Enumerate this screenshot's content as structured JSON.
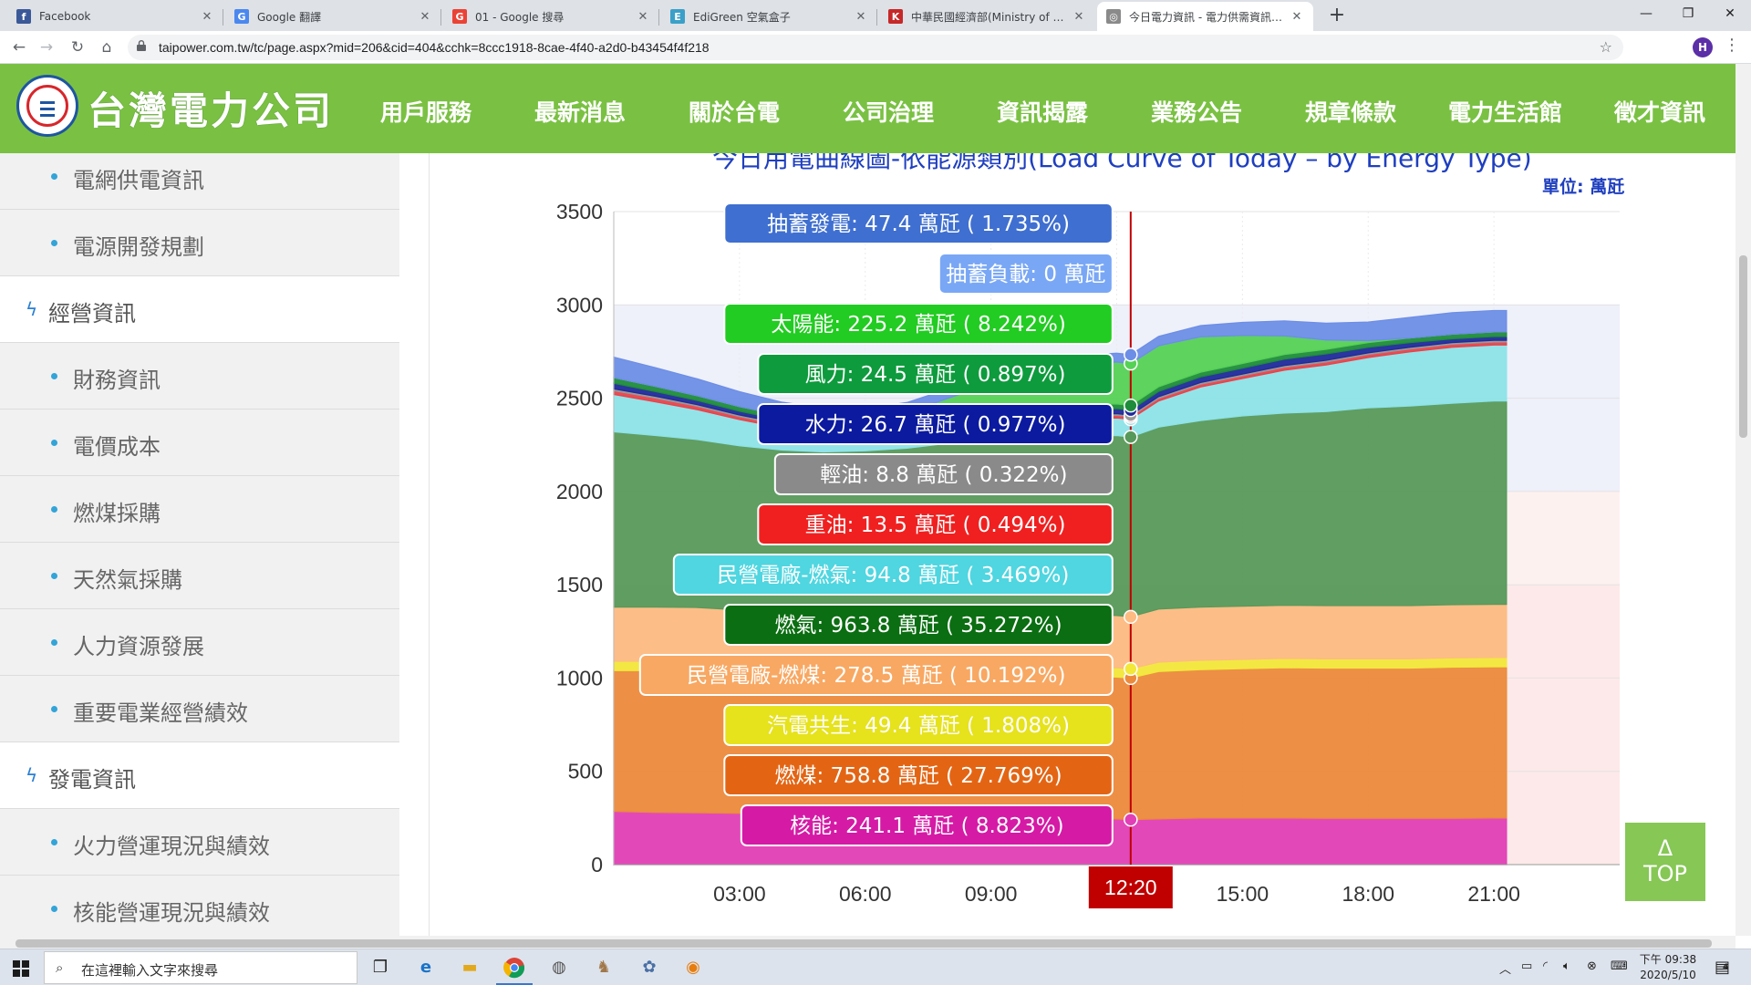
{
  "browser": {
    "tabs": [
      {
        "label": "Facebook",
        "icon": "facebook-icon",
        "color": "#3b5998",
        "glyph": "f"
      },
      {
        "label": "Google 翻譯",
        "icon": "google-translate-icon",
        "color": "#4a88ef",
        "glyph": "G"
      },
      {
        "label": "01 - Google 搜尋",
        "icon": "google-icon",
        "color": "#ea4335",
        "glyph": "G"
      },
      {
        "label": "EdiGreen 空氣盒子",
        "icon": "edigreen-icon",
        "color": "#3aa0c8",
        "glyph": "E"
      },
      {
        "label": "中華民國經濟部(Ministry of Eco",
        "icon": "moea-icon",
        "color": "#c62828",
        "glyph": "K"
      },
      {
        "label": "今日電力資訊 - 電力供需資訊 - 資",
        "icon": "taipower-icon",
        "color": "#8a8a8a",
        "glyph": "◎"
      }
    ],
    "url": "taipower.com.tw/tc/page.aspx?mid=206&cid=404&cchk=8ccc1918-8cae-4f40-a2d0-b43454f4f218",
    "profile_initial": "H"
  },
  "site": {
    "logo_text": "台灣電力公司",
    "nav": [
      "用戶服務",
      "最新消息",
      "關於台電",
      "公司治理",
      "資訊揭露",
      "業務公告",
      "規章條款",
      "電力生活館",
      "徵才資訊"
    ]
  },
  "sidebar": {
    "items": [
      {
        "label": "電網供電資訊",
        "type": "sub"
      },
      {
        "label": "電源開發規劃",
        "type": "sub"
      },
      {
        "label": "經營資訊",
        "type": "cat"
      },
      {
        "label": "財務資訊",
        "type": "sub"
      },
      {
        "label": "電價成本",
        "type": "sub"
      },
      {
        "label": "燃煤採購",
        "type": "sub"
      },
      {
        "label": "天然氣採購",
        "type": "sub"
      },
      {
        "label": "人力資源發展",
        "type": "sub"
      },
      {
        "label": "重要電業經營績效",
        "type": "sub"
      },
      {
        "label": "發電資訊",
        "type": "cat"
      },
      {
        "label": "火力營運現況與績效",
        "type": "sub"
      },
      {
        "label": "核能營運現況與績效",
        "type": "sub"
      }
    ]
  },
  "chart_data": {
    "type": "area",
    "title": "今日用電曲線圖-依能源類別(Load Curve of Today – by Energy Type)",
    "unit": "單位: 萬瓩",
    "ylim": [
      0,
      3500
    ],
    "yticks": [
      0,
      500,
      1000,
      1500,
      2000,
      2500,
      3000,
      3500
    ],
    "xticks": [
      "03:00",
      "06:00",
      "09:00",
      "15:00",
      "18:00",
      "21:00"
    ],
    "xlim": [
      0,
      24
    ],
    "cursor": "12:20",
    "x": [
      0,
      1,
      2,
      3,
      4,
      5,
      6,
      7,
      8,
      9,
      10,
      11,
      12,
      12.33,
      13,
      14,
      15,
      16,
      17,
      18,
      19,
      20,
      21,
      21.3
    ],
    "series": [
      {
        "name": "核能",
        "color": "#e23fb6",
        "tooltip": "核能: 241.1 萬瓩 ( 8.823%)",
        "values": [
          285,
          280,
          278,
          275,
          272,
          270,
          268,
          265,
          262,
          260,
          258,
          250,
          245,
          241,
          245,
          250,
          250,
          250,
          248,
          248,
          248,
          248,
          250,
          250
        ]
      },
      {
        "name": "燃煤",
        "color": "#ec8a3c",
        "tooltip": "燃煤: 758.8 萬瓩 ( 27.769%)",
        "values": [
          755,
          760,
          765,
          760,
          760,
          762,
          765,
          765,
          765,
          765,
          765,
          762,
          760,
          759,
          790,
          795,
          800,
          805,
          805,
          805,
          805,
          810,
          810,
          810
        ]
      },
      {
        "name": "汽電共生",
        "color": "#f2e83a",
        "tooltip": "汽電共生: 49.4 萬瓩 ( 1.808%)",
        "values": [
          50,
          50,
          50,
          50,
          50,
          50,
          50,
          50,
          50,
          50,
          50,
          50,
          50,
          49,
          50,
          50,
          50,
          50,
          50,
          50,
          50,
          50,
          50,
          50
        ]
      },
      {
        "name": "民營電廠-燃煤",
        "color": "#fdbb82",
        "tooltip": "民營電廠-燃煤: 278.5 萬瓩 ( 10.192%)",
        "values": [
          290,
          290,
          285,
          280,
          280,
          280,
          280,
          282,
          282,
          280,
          280,
          280,
          280,
          279,
          285,
          285,
          285,
          285,
          285,
          285,
          285,
          285,
          285,
          285
        ]
      },
      {
        "name": "燃氣",
        "color": "#57995a",
        "tooltip": "燃氣: 963.8 萬瓩 ( 35.272%)",
        "values": [
          940,
          920,
          900,
          880,
          860,
          850,
          855,
          870,
          900,
          920,
          940,
          955,
          965,
          964,
          975,
          1000,
          1020,
          1030,
          1040,
          1060,
          1070,
          1080,
          1090,
          1090
        ]
      },
      {
        "name": "民營電廠-燃氣",
        "color": "#8de3e8",
        "tooltip": "民營電廠-燃氣: 94.8 萬瓩 ( 3.469%)",
        "values": [
          200,
          180,
          160,
          140,
          120,
          105,
          95,
          92,
          92,
          92,
          92,
          93,
          94,
          95,
          140,
          180,
          200,
          230,
          250,
          270,
          290,
          300,
          300,
          300
        ]
      },
      {
        "name": "重油",
        "color": "#e8424a",
        "tooltip": "重油: 13.5 萬瓩 ( 0.494%)",
        "values": [
          20,
          20,
          18,
          16,
          15,
          14,
          14,
          14,
          14,
          14,
          14,
          14,
          14,
          13.5,
          14,
          15,
          15,
          16,
          16,
          16,
          16,
          16,
          16,
          16
        ]
      },
      {
        "name": "輕油",
        "color": "#999999",
        "tooltip": "輕油: 8.8 萬瓩 ( 0.322%)",
        "values": [
          10,
          10,
          9,
          9,
          9,
          9,
          9,
          9,
          9,
          9,
          9,
          9,
          9,
          8.8,
          9,
          9,
          9,
          9,
          9,
          9,
          9,
          9,
          9,
          9
        ]
      },
      {
        "name": "水力",
        "color": "#1f2a9a",
        "tooltip": "水力: 26.7 萬瓩 ( 0.977%)",
        "values": [
          30,
          25,
          22,
          20,
          18,
          18,
          18,
          20,
          22,
          24,
          25,
          26,
          27,
          26.7,
          28,
          30,
          32,
          34,
          34,
          30,
          25,
          20,
          20,
          20
        ]
      },
      {
        "name": "風力",
        "color": "#1e8c3a",
        "tooltip": "風力: 24.5 萬瓩 ( 0.897%)",
        "values": [
          30,
          28,
          26,
          25,
          25,
          25,
          25,
          25,
          25,
          25,
          25,
          25,
          25,
          24.5,
          25,
          25,
          25,
          25,
          25,
          25,
          25,
          25,
          25,
          25
        ]
      },
      {
        "name": "太陽能",
        "color": "#55d155",
        "tooltip": "太陽能: 225.2 萬瓩 ( 8.242%)",
        "values": [
          0,
          0,
          0,
          0,
          0,
          0,
          5,
          30,
          80,
          140,
          190,
          215,
          225,
          225.2,
          220,
          190,
          150,
          100,
          50,
          10,
          0,
          0,
          0,
          0
        ]
      },
      {
        "name": "抽蓄負載",
        "color": "#79a7f5",
        "tooltip": "抽蓄負載: 0 萬瓩",
        "values": [
          0,
          0,
          0,
          0,
          0,
          0,
          0,
          0,
          0,
          0,
          0,
          0,
          0,
          0,
          0,
          0,
          0,
          0,
          0,
          0,
          0,
          0,
          0,
          0
        ]
      },
      {
        "name": "抽蓄發電",
        "color": "#6d8ee6",
        "tooltip": "抽蓄發電: 47.4 萬瓩 ( 1.735%)",
        "values": [
          110,
          100,
          90,
          80,
          70,
          65,
          60,
          55,
          50,
          50,
          50,
          48,
          47,
          47.4,
          50,
          60,
          70,
          80,
          90,
          100,
          110,
          115,
          115,
          115
        ]
      }
    ],
    "tooltip_colors": {
      "抽蓄發電": "#3f6fd0",
      "抽蓄負載": "#79a7f5",
      "太陽能": "#22cc22",
      "風力": "#0e9b3d",
      "水力": "#0b1a9f",
      "輕油": "#8a8a8a",
      "重油": "#f02020",
      "民營電廠-燃氣": "#4fd6e0",
      "燃氣": "#0b6e12",
      "民營電廠-燃煤": "#f8a862",
      "汽電共生": "#e6e21c",
      "燃煤": "#e36514",
      "核能": "#d51aa6"
    }
  },
  "top_button": {
    "arrow": "Δ",
    "label": "TOP"
  },
  "taskbar": {
    "search_placeholder": "在這裡輸入文字來搜尋",
    "time": "下午 09:38",
    "date": "2020/5/10",
    "notifications": "4"
  }
}
